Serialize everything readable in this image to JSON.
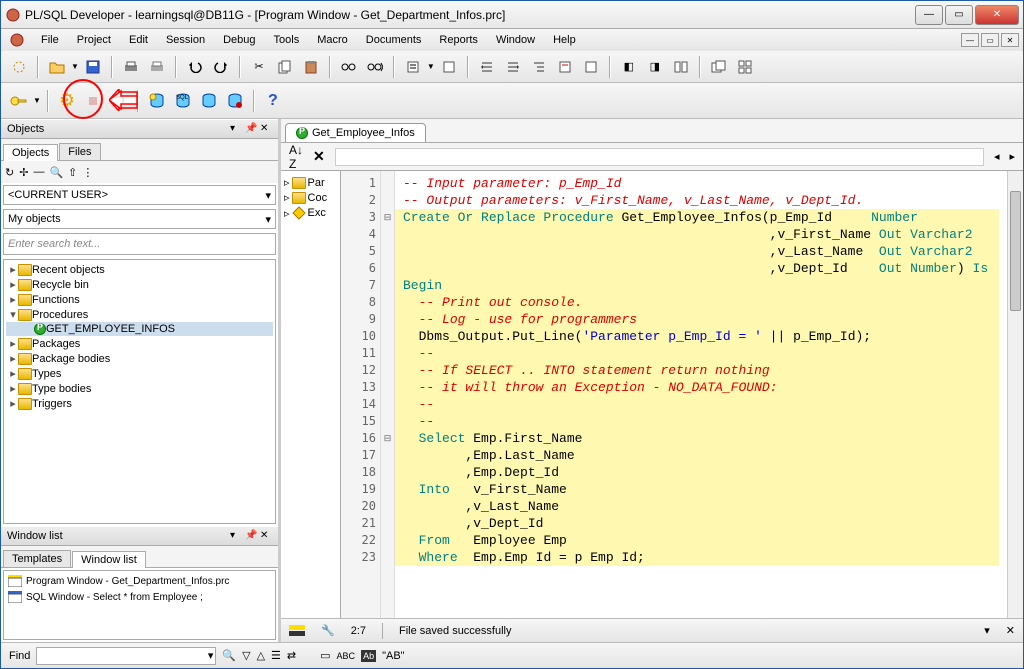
{
  "window": {
    "title": "PL/SQL Developer - learningsql@DB11G - [Program Window - Get_Department_Infos.prc]"
  },
  "menu": {
    "items": [
      "File",
      "Project",
      "Edit",
      "Session",
      "Debug",
      "Tools",
      "Macro",
      "Documents",
      "Reports",
      "Window",
      "Help"
    ]
  },
  "objects_panel": {
    "title": "Objects",
    "tabs": [
      "Objects",
      "Files"
    ],
    "combo1": "<CURRENT USER>",
    "combo2": "My objects",
    "search_placeholder": "Enter search text...",
    "tree": [
      {
        "label": "Recent objects",
        "lvl": 0,
        "exp": false
      },
      {
        "label": "Recycle bin",
        "lvl": 0,
        "exp": false
      },
      {
        "label": "Functions",
        "lvl": 0,
        "exp": false
      },
      {
        "label": "Procedures",
        "lvl": 0,
        "exp": true
      },
      {
        "label": "GET_EMPLOYEE_INFOS",
        "lvl": 1,
        "exp": false,
        "proc": true,
        "sel": true
      },
      {
        "label": "Packages",
        "lvl": 0,
        "exp": false
      },
      {
        "label": "Package bodies",
        "lvl": 0,
        "exp": false
      },
      {
        "label": "Types",
        "lvl": 0,
        "exp": false
      },
      {
        "label": "Type bodies",
        "lvl": 0,
        "exp": false
      },
      {
        "label": "Triggers",
        "lvl": 0,
        "exp": false
      }
    ]
  },
  "windowlist_panel": {
    "title": "Window list",
    "tabs": [
      "Templates",
      "Window list"
    ],
    "items": [
      "Program Window - Get_Department_Infos.prc",
      "SQL Window - Select * from Employee ;"
    ]
  },
  "nav_items": [
    "Par",
    "Coc",
    "Exc"
  ],
  "doc_tab": "Get_Employee_Infos",
  "code_lines": [
    {
      "n": 1,
      "html": "<span class='cm'>-- Input parameter: p_Emp_Id</span>"
    },
    {
      "n": 2,
      "html": "<span class='cm'>-- Output parameters: v_First_Name, v_Last_Name, v_Dept_Id.</span>"
    },
    {
      "n": 3,
      "fold": "⊟",
      "hl": true,
      "html": "<span class='kw'>Create Or Replace Procedure</span> Get_Employee_Infos(p_Emp_Id     <span class='kw'>Number</span>"
    },
    {
      "n": 4,
      "hl": true,
      "html": "                                               ,v_First_Name <span class='kw'>Out Varchar2</span>"
    },
    {
      "n": 5,
      "hl": true,
      "html": "                                               ,v_Last_Name  <span class='kw'>Out Varchar2</span>"
    },
    {
      "n": 6,
      "hl": true,
      "html": "                                               ,v_Dept_Id    <span class='kw'>Out Number</span>) <span class='kw'>Is</span>"
    },
    {
      "n": 7,
      "hl": true,
      "html": "<span class='kw'>Begin</span>"
    },
    {
      "n": 8,
      "hl": true,
      "html": "  <span class='cm'>-- Print out console.</span>"
    },
    {
      "n": 9,
      "hl": true,
      "html": "  <span class='cm'>-- Log - use for programmers</span>"
    },
    {
      "n": 10,
      "hl": true,
      "html": "  Dbms_Output.Put_Line(<span class='str'>'Parameter p_Emp_Id = '</span> || p_Emp_Id);"
    },
    {
      "n": 11,
      "hl": true,
      "html": "  <span class='cm'>--</span>"
    },
    {
      "n": 12,
      "hl": true,
      "html": "  <span class='cm'>-- If SELECT .. INTO statement return nothing</span>"
    },
    {
      "n": 13,
      "hl": true,
      "html": "  <span class='cm'>-- it will throw an Exception - NO_DATA_FOUND:</span>"
    },
    {
      "n": 14,
      "hl": true,
      "html": "  <span class='cm'>--</span>"
    },
    {
      "n": 15,
      "hl": true,
      "html": "  <span class='cm'>--</span>"
    },
    {
      "n": 16,
      "fold": "⊟",
      "hl": true,
      "html": "  <span class='kw'>Select</span> Emp.First_Name"
    },
    {
      "n": 17,
      "hl": true,
      "html": "        ,Emp.Last_Name"
    },
    {
      "n": 18,
      "hl": true,
      "html": "        ,Emp.Dept_Id"
    },
    {
      "n": 19,
      "hl": true,
      "html": "  <span class='kw'>Into</span>   v_First_Name"
    },
    {
      "n": 20,
      "hl": true,
      "html": "        ,v_Last_Name"
    },
    {
      "n": 21,
      "hl": true,
      "html": "        ,v_Dept_Id"
    },
    {
      "n": 22,
      "hl": true,
      "html": "  <span class='kw'>From</span>   Employee Emp"
    },
    {
      "n": 23,
      "hl": true,
      "html": "  <span class='kw'>Where</span>  Emp.Emp Id = p Emp Id;"
    }
  ],
  "status": {
    "pos": "2:7",
    "msg": "File saved successfully"
  },
  "find": {
    "label": "Find",
    "quote": "\"AB\""
  }
}
